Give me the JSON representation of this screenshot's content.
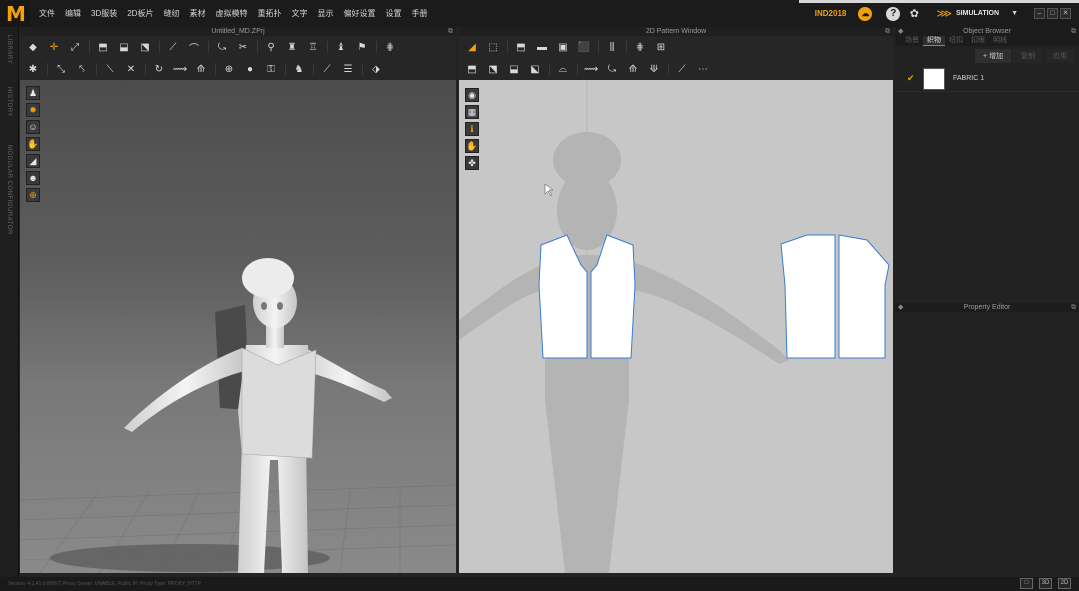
{
  "app": {
    "logo": "M"
  },
  "menu": [
    "文件",
    "编辑",
    "3D服装",
    "2D板片",
    "缝纫",
    "素材",
    "虚拟模特",
    "重拓扑",
    "文字",
    "显示",
    "偏好设置",
    "设置",
    "手册"
  ],
  "topbar": {
    "badge": "IND2018",
    "mode": "SIMULATION",
    "mode_dropdown": "▼"
  },
  "window3d": {
    "title": "Untitled_MD.ZPrj"
  },
  "window2d": {
    "title": "2D Pattern Window"
  },
  "left_strip": {
    "labels": [
      "LIBRARY",
      "HISTORY",
      "MODULAR CONFIGURATOR"
    ]
  },
  "object_browser": {
    "title": "Object Browser",
    "tabs": [
      "场景",
      "织物",
      "纽扣",
      "扣眼",
      "明线"
    ],
    "active_tab": 1,
    "add_button": "+ 增加",
    "buttons_disabled": [
      "复制",
      "应用"
    ],
    "fabrics": [
      {
        "name": "FABRIC 1",
        "checked": true,
        "color": "#ffffff"
      }
    ]
  },
  "property_editor": {
    "title": "Property Editor"
  },
  "statusbar": {
    "text": "Version: 4.1.41  (r26667)    Proxy Server: UNABLE, Public IP:    Proxy Type: PROXY_HTTP",
    "view_modes": [
      "□",
      "3D",
      "2D"
    ]
  },
  "icons": {
    "side3d": [
      "avatar-icon",
      "rotate-icon",
      "person-icon",
      "hand-icon",
      "fold-icon",
      "avatar-select-icon",
      "globe-icon"
    ],
    "side2d": [
      "eye-icon",
      "pattern-icon",
      "info-icon",
      "hand-icon",
      "puzzle-icon"
    ]
  },
  "colors": {
    "accent": "#f2a10a",
    "pattern_outline": "#3a7bd5",
    "pattern_fill": "#ffffff"
  }
}
